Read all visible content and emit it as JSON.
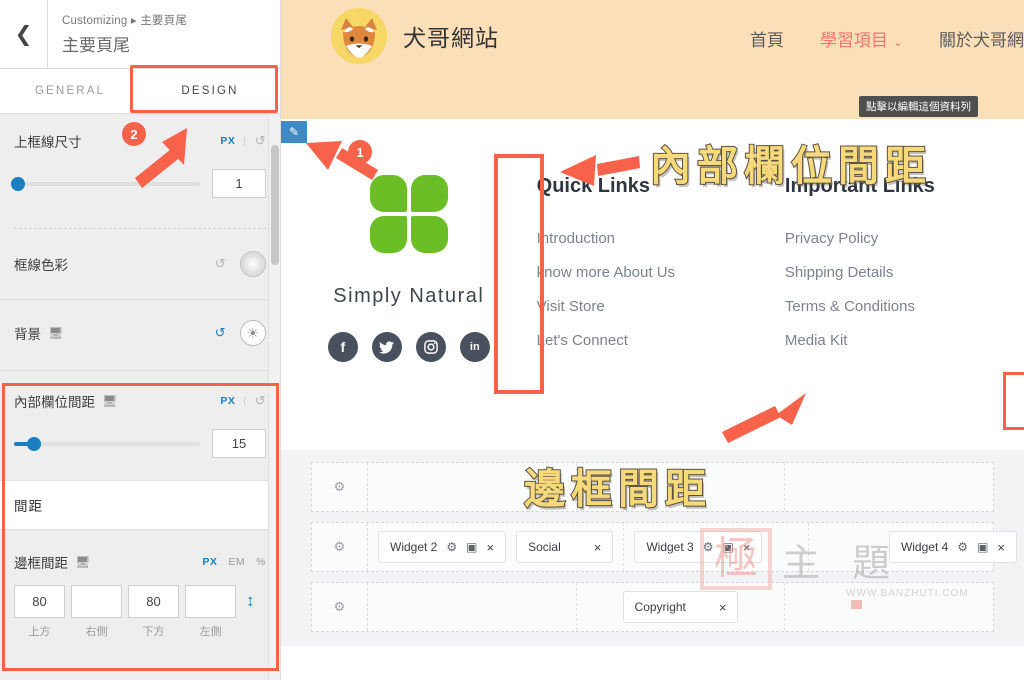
{
  "customizer": {
    "back_icon": "chevron-left-icon",
    "breadcrumb": "Customizing ▸ 主要頁尾",
    "title": "主要頁尾",
    "tabs": [
      {
        "label": "GENERAL",
        "active": false
      },
      {
        "label": "DESIGN",
        "active": true
      }
    ],
    "controls": {
      "border_size": {
        "label": "上框線尺寸",
        "unit": "PX",
        "reset_icon": "reset-icon",
        "value": "1",
        "slider_percent": 2
      },
      "border_color": {
        "label": "框線色彩",
        "reset_icon": "reset-icon",
        "swatch_icon": "color-swatch-icon"
      },
      "background": {
        "label": "背景",
        "device_icon": "desktop-icon",
        "reset_icon": "reset-icon",
        "picker_icon": "globe-icon"
      },
      "inner_column_spacing": {
        "label": "內部欄位間距",
        "device_icon": "desktop-icon",
        "unit": "PX",
        "reset_icon": "reset-icon",
        "value": "15",
        "slider_percent": 11
      },
      "spacing_section": {
        "label": "間距"
      },
      "padding": {
        "label": "邊框間距",
        "device_icon": "desktop-icon",
        "units": [
          {
            "label": "PX",
            "active": true
          },
          {
            "label": "EM",
            "active": false
          },
          {
            "label": "%",
            "active": false
          }
        ],
        "link_icon": "link-values-icon",
        "fields": [
          {
            "value": "80",
            "caption": "上方"
          },
          {
            "value": "",
            "caption": "右側"
          },
          {
            "value": "80",
            "caption": "下方"
          },
          {
            "value": "",
            "caption": "左側"
          }
        ]
      }
    }
  },
  "preview": {
    "site_header": {
      "logo_icon": "fox-avatar-icon",
      "site_name": "犬哥網站",
      "background_color": "#fbdfb8",
      "nav": [
        {
          "label": "首頁",
          "active": false,
          "has_caret": false
        },
        {
          "label": "學習項目",
          "active": true,
          "has_caret": true
        },
        {
          "label": "關於犬哥網",
          "active": false,
          "has_caret": false
        }
      ],
      "tooltip": "點擊以編輯這個資料列"
    },
    "footer": {
      "edit_icon": "pencil-edit-icon",
      "brand": {
        "logo_icon": "four-leaf-icon",
        "logo_color": "#6cbe26",
        "name": "Simply Natural",
        "socials": [
          {
            "name": "facebook-icon",
            "glyph": "f"
          },
          {
            "name": "twitter-icon",
            "glyph": "🐦"
          },
          {
            "name": "instagram-icon",
            "glyph": "◉"
          },
          {
            "name": "linkedin-icon",
            "glyph": "in"
          }
        ]
      },
      "columns": [
        {
          "title": "Quick Links",
          "links": [
            "Introduction",
            "know more About Us",
            "Visit Store",
            "Let's Connect"
          ]
        },
        {
          "title": "Important Links",
          "links": [
            "Privacy Policy",
            "Shipping Details",
            "Terms & Conditions",
            "Media Kit"
          ]
        }
      ]
    },
    "widget_rows": [
      {
        "gear_icon": "gear-icon",
        "cells": [
          {
            "chips": []
          },
          {
            "chips": []
          },
          {
            "chips": []
          }
        ]
      },
      {
        "gear_icon": "gear-icon",
        "cells": [
          {
            "chips": [
              {
                "label": "Widget 2",
                "icons": [
                  "gear-icon",
                  "duplicate-icon"
                ],
                "close": "×"
              },
              {
                "label": "Social",
                "icons": [],
                "close": "×"
              }
            ]
          },
          {
            "chips": [
              {
                "label": "Widget 3",
                "icons": [
                  "gear-icon",
                  "duplicate-icon"
                ],
                "close": "×"
              }
            ]
          },
          {
            "chips": [
              {
                "label": "Widget 4",
                "icons": [
                  "gear-icon",
                  "duplicate-icon"
                ],
                "close": "×"
              }
            ]
          }
        ]
      },
      {
        "gear_icon": "gear-icon",
        "cells": [
          {
            "chips": []
          },
          {
            "chips": [
              {
                "label": "Copyright",
                "icons": [],
                "close": "×"
              }
            ],
            "center": true
          },
          {
            "chips": []
          }
        ]
      }
    ]
  },
  "annotations": {
    "accent_color": "#f8614a",
    "callout_color": "#f6d97a",
    "badges": [
      {
        "number": "1"
      },
      {
        "number": "2"
      }
    ],
    "callouts": [
      {
        "text": "內部欄位間距"
      },
      {
        "text": "邊框間距"
      }
    ]
  },
  "watermark": {
    "stamp": "極",
    "text": "主 題",
    "url": "WWW.BANZHUTI.COM"
  }
}
